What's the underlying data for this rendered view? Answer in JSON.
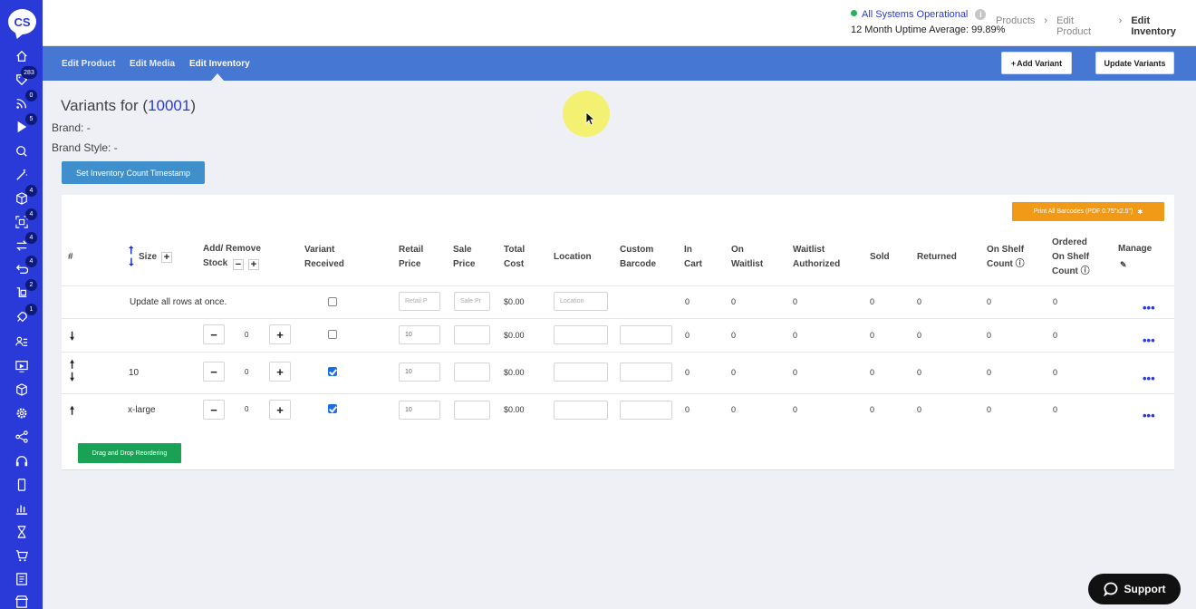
{
  "sidebar": {
    "logo": "CS",
    "items": [
      {
        "name": "home-icon"
      },
      {
        "name": "tag-icon",
        "badge": "283"
      },
      {
        "name": "rss-icon",
        "badge": "0"
      },
      {
        "name": "play-icon",
        "badge": "5"
      },
      {
        "name": "chat-icon"
      },
      {
        "name": "magic-wand-icon"
      },
      {
        "name": "cube-icon",
        "badge": "4"
      },
      {
        "name": "scan-icon",
        "badge": "4"
      },
      {
        "name": "exchange-icon",
        "badge": "4"
      },
      {
        "name": "return-icon",
        "badge": "4"
      },
      {
        "name": "dolly-icon",
        "badge": "2"
      },
      {
        "name": "rocket-icon",
        "badge": "1"
      },
      {
        "name": "users-list-icon"
      },
      {
        "name": "monitor-icon"
      },
      {
        "name": "box-icon"
      },
      {
        "name": "settings-icon"
      },
      {
        "name": "share-icon"
      },
      {
        "name": "headset-icon"
      },
      {
        "name": "mobile-icon"
      },
      {
        "name": "bar-chart-icon"
      },
      {
        "name": "hourglass-icon"
      },
      {
        "name": "cart-icon"
      },
      {
        "name": "document-icon"
      },
      {
        "name": "store-icon"
      }
    ]
  },
  "header": {
    "status_text": "All Systems Operational",
    "uptime": "12 Month Uptime Average: 99.89%",
    "breadcrumbs": [
      "Products",
      "Edit Product",
      "Edit Inventory"
    ]
  },
  "tabs": [
    "Edit Product",
    "Edit Media",
    "Edit Inventory"
  ],
  "actions": {
    "add_variant": "Add Variant",
    "update_variants": "Update Variants"
  },
  "page": {
    "title_prefix": "Variants for (",
    "product_id": "10001",
    "title_suffix": ")",
    "brand": "Brand: -",
    "brand_style": "Brand Style: -",
    "timestamp_button": "Set Inventory Count Timestamp"
  },
  "table": {
    "print_button": "Print All Barcodes (PDF 0.75\"x2.5\")",
    "headers": {
      "num": "#",
      "size": "Size",
      "stock_1": "Add/ Remove",
      "stock_2": "Stock",
      "received_1": "Variant",
      "received_2": "Received",
      "retail_1": "Retail",
      "retail_2": "Price",
      "sale_1": "Sale",
      "sale_2": "Price",
      "total_1": "Total",
      "total_2": "Cost",
      "location": "Location",
      "barcode_1": "Custom",
      "barcode_2": "Barcode",
      "cart_1": "In",
      "cart_2": "Cart",
      "waitlist_1": "On",
      "waitlist_2": "Waitlist",
      "wauth_1": "Waitlist",
      "wauth_2": "Authorized",
      "sold": "Sold",
      "returned": "Returned",
      "shelf_1": "On Shelf",
      "shelf_2": "Count",
      "ordered_1": "Ordered",
      "ordered_2": "On Shelf",
      "ordered_3": "Count",
      "manage": "Manage"
    },
    "bulk_row": {
      "label": "Update all rows at once.",
      "retail_placeholder": "Retail P",
      "sale_placeholder": "Sale Pr",
      "total": "$0.00",
      "location_placeholder": "Location",
      "in_cart": "0",
      "on_waitlist": "0",
      "wait_auth": "0",
      "sold": "0",
      "returned": "0",
      "on_shelf": "0",
      "ordered": "0"
    },
    "rows": [
      {
        "size": "",
        "stock": "0",
        "received": false,
        "retail": "10",
        "total": "$0.00",
        "in_cart": "0",
        "on_waitlist": "0",
        "wait_auth": "0",
        "sold": "0",
        "returned": "0",
        "on_shelf": "0",
        "ordered": "0"
      },
      {
        "size": "10",
        "stock": "0",
        "received": true,
        "retail": "10",
        "total": "$0.00",
        "in_cart": "0",
        "on_waitlist": "0",
        "wait_auth": "0",
        "sold": "0",
        "returned": "0",
        "on_shelf": "0",
        "ordered": "0"
      },
      {
        "size": "x-large",
        "stock": "0",
        "received": true,
        "retail": "10",
        "total": "$0.00",
        "in_cart": "0",
        "on_waitlist": "0",
        "wait_auth": "0",
        "sold": "0",
        "returned": "0",
        "on_shelf": "0",
        "ordered": "0"
      }
    ],
    "drag_button": "Drag and Drop Reordering",
    "more": "•••"
  },
  "support": "Support"
}
